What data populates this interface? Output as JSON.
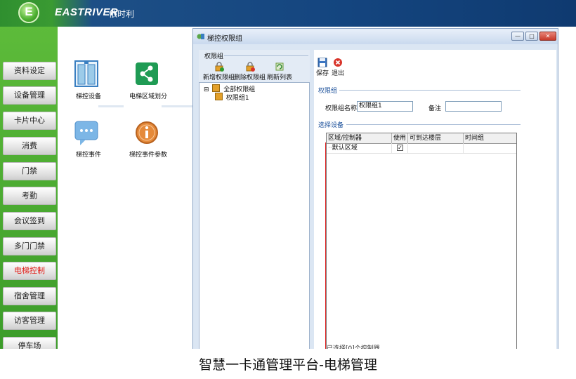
{
  "header": {
    "logo_letter": "E",
    "brand": "EASTRIVER",
    "brand_cn": "依时利"
  },
  "sidebar": {
    "items": [
      {
        "label": "资料设定",
        "active": false
      },
      {
        "label": "设备管理",
        "active": false
      },
      {
        "label": "卡片中心",
        "active": false
      },
      {
        "label": "消费",
        "active": false
      },
      {
        "label": "门禁",
        "active": false
      },
      {
        "label": "考勤",
        "active": false
      },
      {
        "label": "会议签到",
        "active": false
      },
      {
        "label": "多门门禁",
        "active": false
      },
      {
        "label": "电梯控制",
        "active": true
      },
      {
        "label": "宿舍管理",
        "active": false
      },
      {
        "label": "访客管理",
        "active": false
      },
      {
        "label": "停车场",
        "active": false
      }
    ],
    "active_color": "#e0201b"
  },
  "desktop": {
    "icons": [
      {
        "label": "梯控设备",
        "icon": "elevator-device-icon"
      },
      {
        "label": "电梯区域划分",
        "icon": "share-icon"
      },
      {
        "label": "梯控事件",
        "icon": "chat-bubble-icon"
      },
      {
        "label": "梯控事件参数",
        "icon": "info-icon"
      }
    ]
  },
  "window": {
    "title": "梯控权限组",
    "controls": {
      "minimize": "—",
      "maximize": "□",
      "close": "✕"
    },
    "left_panel": {
      "group_title": "权限组",
      "toolbar": [
        {
          "label": "新增权限组",
          "icon": "add-lock-icon"
        },
        {
          "label": "删除权限组",
          "icon": "delete-lock-icon"
        },
        {
          "label": "刷新列表",
          "icon": "refresh-icon"
        }
      ],
      "tree": {
        "root": {
          "label": "全部权限组",
          "expander": "⊟"
        },
        "children": [
          {
            "label": "权限组1"
          }
        ]
      }
    },
    "right_panel": {
      "toolbar": [
        {
          "label": "保存",
          "icon": "save-icon"
        },
        {
          "label": "退出",
          "icon": "exit-icon"
        }
      ],
      "section_group": "权限组",
      "fields": {
        "name_label": "权限组名称",
        "name_value": "权限组1",
        "remark_label": "备注",
        "remark_value": ""
      },
      "section_devices": "选择设备",
      "grid": {
        "columns": [
          "区域/控制器",
          "使用",
          "可到达楼层",
          "时间组"
        ],
        "rows": [
          {
            "area": "默认区域",
            "used": true,
            "floors": "",
            "time_group": ""
          }
        ]
      },
      "status_text": "已选择[0]个控制器"
    }
  },
  "caption": "智慧一卡通管理平台-电梯管理",
  "colors": {
    "topbar_blue": "#14457f",
    "sidebar_green": "#4caf30",
    "window_bg": "#dbe6f3",
    "section_blue": "#1a4f9a"
  }
}
